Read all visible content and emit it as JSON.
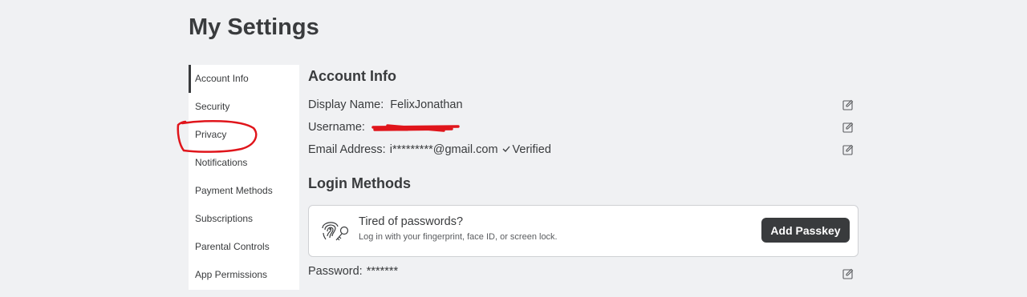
{
  "page": {
    "title": "My Settings"
  },
  "sidebar": {
    "items": [
      {
        "label": "Account Info",
        "active": true
      },
      {
        "label": "Security"
      },
      {
        "label": "Privacy"
      },
      {
        "label": "Notifications"
      },
      {
        "label": "Payment Methods"
      },
      {
        "label": "Subscriptions"
      },
      {
        "label": "Parental Controls"
      },
      {
        "label": "App Permissions"
      }
    ]
  },
  "account_info": {
    "title": "Account Info",
    "display_name": {
      "label": "Display Name:",
      "value": "FelixJonathan"
    },
    "username": {
      "label": "Username:"
    },
    "email": {
      "label": "Email Address:",
      "value": "i*********@gmail.com",
      "status": "Verified"
    }
  },
  "login_methods": {
    "title": "Login Methods",
    "passkey": {
      "title": "Tired of passwords?",
      "subtitle": "Log in with your fingerprint, face ID, or screen lock.",
      "button": "Add Passkey"
    },
    "password": {
      "label": "Password:",
      "value": "*******"
    }
  },
  "colors": {
    "text": "#393b3d",
    "background": "#f0f1f3",
    "annotation": "#e0151b",
    "button": "#393b3d"
  }
}
